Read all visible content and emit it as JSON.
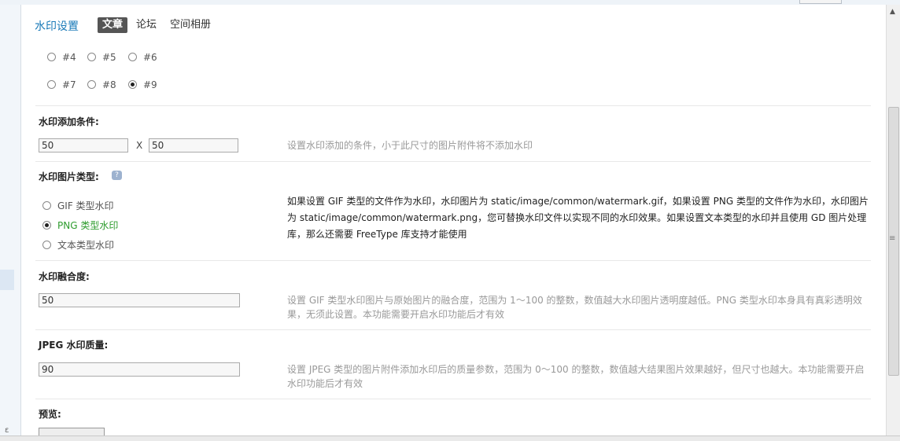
{
  "page": {
    "title": "水印设置"
  },
  "tabs": [
    {
      "label": "文章",
      "active": true
    },
    {
      "label": "论坛",
      "active": false
    },
    {
      "label": "空间相册",
      "active": false
    }
  ],
  "positions": [
    {
      "label": "#4",
      "checked": false
    },
    {
      "label": "#5",
      "checked": false
    },
    {
      "label": "#6",
      "checked": false
    },
    {
      "label": "#7",
      "checked": false
    },
    {
      "label": "#8",
      "checked": false
    },
    {
      "label": "#9",
      "checked": true
    }
  ],
  "condition": {
    "label": "水印添加条件:",
    "width": "50",
    "separator": "X",
    "height": "50",
    "tip": "设置水印添加的条件，小于此尺寸的图片附件将不添加水印"
  },
  "imagetype": {
    "label": "水印图片类型:",
    "help_icon": "question-icon",
    "options": [
      {
        "label": "GIF 类型水印",
        "checked": false
      },
      {
        "label": "PNG 类型水印",
        "checked": true
      },
      {
        "label": "文本类型水印",
        "checked": false
      }
    ],
    "tip": "如果设置 GIF 类型的文件作为水印，水印图片为 static/image/common/watermark.gif，如果设置 PNG 类型的文件作为水印，水印图片为 static/image/common/watermark.png，您可替换水印文件以实现不同的水印效果。如果设置文本类型的水印并且使用 GD 图片处理库，那么还需要 FreeType 库支持才能使用"
  },
  "blend": {
    "label": "水印融合度:",
    "value": "50",
    "tip": "设置 GIF 类型水印图片与原始图片的融合度，范围为 1～100 的整数，数值越大水印图片透明度越低。PNG 类型水印本身具有真彩透明效果，无须此设置。本功能需要开启水印功能后才有效"
  },
  "quality": {
    "label": "JPEG 水印质量:",
    "value": "90",
    "tip": "设置 JPEG 类型的图片附件添加水印后的质量参数，范围为 0～100 的整数，数值越大结果图片效果越好，但尺寸也越大。本功能需要开启水印功能后才有效"
  },
  "preview": {
    "label": "预览:"
  },
  "colors": {
    "accent": "#1a7ab8",
    "selected_option": "#2e9c2e",
    "tab_active_bg": "#555555"
  }
}
